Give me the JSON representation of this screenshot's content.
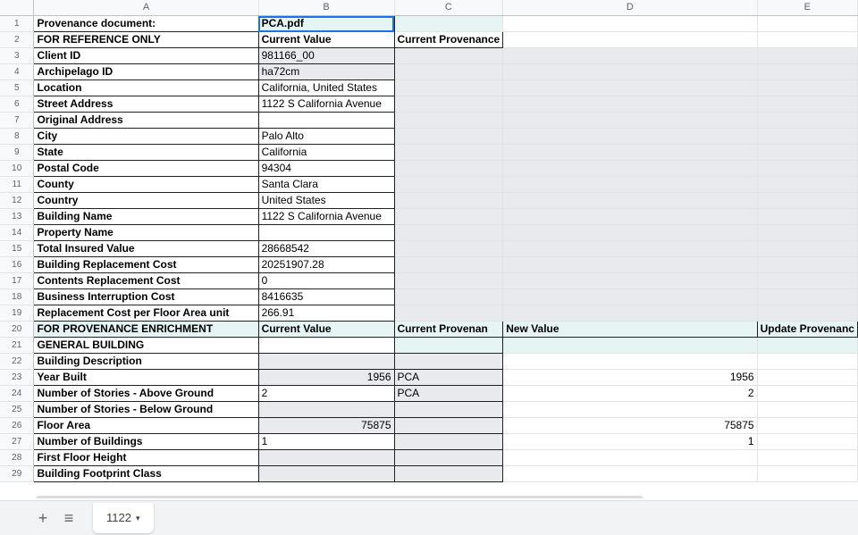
{
  "columns": [
    "A",
    "B",
    "C",
    "D",
    "E"
  ],
  "rows": [
    {
      "n": "1",
      "a": "Provenance document:",
      "b": "PCA.pdf",
      "c": "",
      "d": "",
      "e": ""
    },
    {
      "n": "2",
      "a": "FOR REFERENCE ONLY",
      "b": "Current Value",
      "c": "Current Provenance",
      "d": "",
      "e": ""
    },
    {
      "n": "3",
      "a": "Client ID",
      "b": "981166_00",
      "c": "",
      "d": "",
      "e": ""
    },
    {
      "n": "4",
      "a": "Archipelago ID",
      "b": "ha72cm",
      "c": "",
      "d": "",
      "e": ""
    },
    {
      "n": "5",
      "a": "Location",
      "b": "California, United States",
      "c": "",
      "d": "",
      "e": ""
    },
    {
      "n": "6",
      "a": "Street Address",
      "b": "1122 S California Avenue",
      "c": "",
      "d": "",
      "e": ""
    },
    {
      "n": "7",
      "a": "Original Address",
      "b": "",
      "c": "",
      "d": "",
      "e": ""
    },
    {
      "n": "8",
      "a": "City",
      "b": "Palo Alto",
      "c": "",
      "d": "",
      "e": ""
    },
    {
      "n": "9",
      "a": "State",
      "b": "California",
      "c": "",
      "d": "",
      "e": ""
    },
    {
      "n": "10",
      "a": "Postal Code",
      "b": "94304",
      "c": "",
      "d": "",
      "e": ""
    },
    {
      "n": "11",
      "a": "County",
      "b": "Santa Clara",
      "c": "",
      "d": "",
      "e": ""
    },
    {
      "n": "12",
      "a": "Country",
      "b": "United States",
      "c": "",
      "d": "",
      "e": ""
    },
    {
      "n": "13",
      "a": "Building Name",
      "b": "1122 S California Avenue",
      "c": "",
      "d": "",
      "e": ""
    },
    {
      "n": "14",
      "a": "Property Name",
      "b": "",
      "c": "",
      "d": "",
      "e": ""
    },
    {
      "n": "15",
      "a": "Total Insured Value",
      "b": "28668542",
      "c": "",
      "d": "",
      "e": ""
    },
    {
      "n": "16",
      "a": "Building Replacement Cost",
      "b": "20251907.28",
      "c": "",
      "d": "",
      "e": ""
    },
    {
      "n": "17",
      "a": "Contents Replacement Cost",
      "b": "0",
      "c": "",
      "d": "",
      "e": ""
    },
    {
      "n": "18",
      "a": "Business Interruption Cost",
      "b": "8416635",
      "c": "",
      "d": "",
      "e": ""
    },
    {
      "n": "19",
      "a": "Replacement Cost per Floor Area unit",
      "b": "266.91",
      "c": "",
      "d": "",
      "e": ""
    },
    {
      "n": "20",
      "a": "FOR PROVENANCE ENRICHMENT",
      "b": "Current Value",
      "c": "Current Provenan",
      "d": "New Value",
      "e": "Update Provenanc"
    },
    {
      "n": "21",
      "a": "GENERAL BUILDING",
      "b": "",
      "c": "",
      "d": "",
      "e": ""
    },
    {
      "n": "22",
      "a": "Building Description",
      "b": "",
      "c": "",
      "d": "",
      "e": ""
    },
    {
      "n": "23",
      "a": "Year Built",
      "b": "1956",
      "c": "PCA",
      "d": "1956",
      "e": ""
    },
    {
      "n": "24",
      "a": "Number of Stories - Above Ground",
      "b": "2",
      "c": "PCA",
      "d": "2",
      "e": ""
    },
    {
      "n": "25",
      "a": "Number of Stories - Below Ground",
      "b": "",
      "c": "",
      "d": "",
      "e": ""
    },
    {
      "n": "26",
      "a": "Floor Area",
      "b": "75875",
      "c": "",
      "d": "75875",
      "e": ""
    },
    {
      "n": "27",
      "a": "Number of Buildings",
      "b": "1",
      "c": "",
      "d": "1",
      "e": ""
    },
    {
      "n": "28",
      "a": "First Floor Height",
      "b": "",
      "c": "",
      "d": "",
      "e": ""
    },
    {
      "n": "29",
      "a": "Building Footprint Class",
      "b": "",
      "c": "",
      "d": "",
      "e": ""
    }
  ],
  "tabbar": {
    "add_icon": "+",
    "list_icon": "≡",
    "sheet_name": "1122",
    "caret_icon": "▾"
  }
}
